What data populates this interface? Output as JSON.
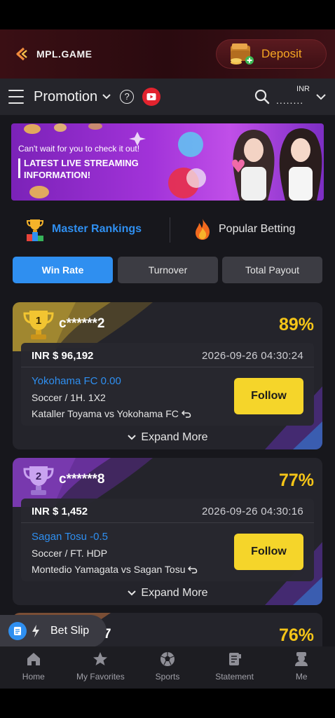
{
  "header": {
    "brand": "MPL.GAME",
    "deposit_label": "Deposit"
  },
  "nav": {
    "title": "Promotion",
    "help": "?",
    "currency": "INR",
    "balance_masked": "........"
  },
  "banner": {
    "subtitle": "Can't wait for you to check it out!",
    "headline": "LATEST LIVE STREAMING INFORMATION!"
  },
  "ranking_tabs": [
    {
      "label": "Master Rankings",
      "active": true
    },
    {
      "label": "Popular Betting",
      "active": false
    }
  ],
  "filters": [
    {
      "label": "Win Rate",
      "active": true
    },
    {
      "label": "Turnover",
      "active": false
    },
    {
      "label": "Total Payout",
      "active": false
    }
  ],
  "cards": [
    {
      "rank": "1",
      "user": "c******2",
      "win_rate": "89%",
      "amount": "INR $ 96,192",
      "time": "2026-09-26 04:30:24",
      "pick": "Yokohama FC 0.00",
      "market": "Soccer / 1H. 1X2",
      "match": "Kataller Toyama vs Yokohama FC",
      "follow_label": "Follow",
      "expand_label": "Expand More"
    },
    {
      "rank": "2",
      "user": "c******8",
      "win_rate": "77%",
      "amount": "INR $ 1,452",
      "time": "2026-09-26 04:30:16",
      "pick": "Sagan Tosu -0.5",
      "market": "Soccer / FT. HDP",
      "match": "Montedio Yamagata vs Sagan Tosu",
      "follow_label": "Follow",
      "expand_label": "Expand More"
    },
    {
      "user_tail": "7",
      "win_rate": "76%"
    }
  ],
  "bet_slip": {
    "label": "Bet Slip"
  },
  "bottom_nav": [
    {
      "label": "Home",
      "icon": "home-icon"
    },
    {
      "label": "My Favorites",
      "icon": "star-icon"
    },
    {
      "label": "Sports",
      "icon": "soccer-ball-icon"
    },
    {
      "label": "Statement",
      "icon": "statement-icon"
    },
    {
      "label": "Me",
      "icon": "user-icon"
    }
  ],
  "colors": {
    "accent_blue": "#2f8ff0",
    "gold": "#f5c518",
    "follow_yellow": "#f5d52a",
    "deposit_orange": "#f5a623"
  }
}
